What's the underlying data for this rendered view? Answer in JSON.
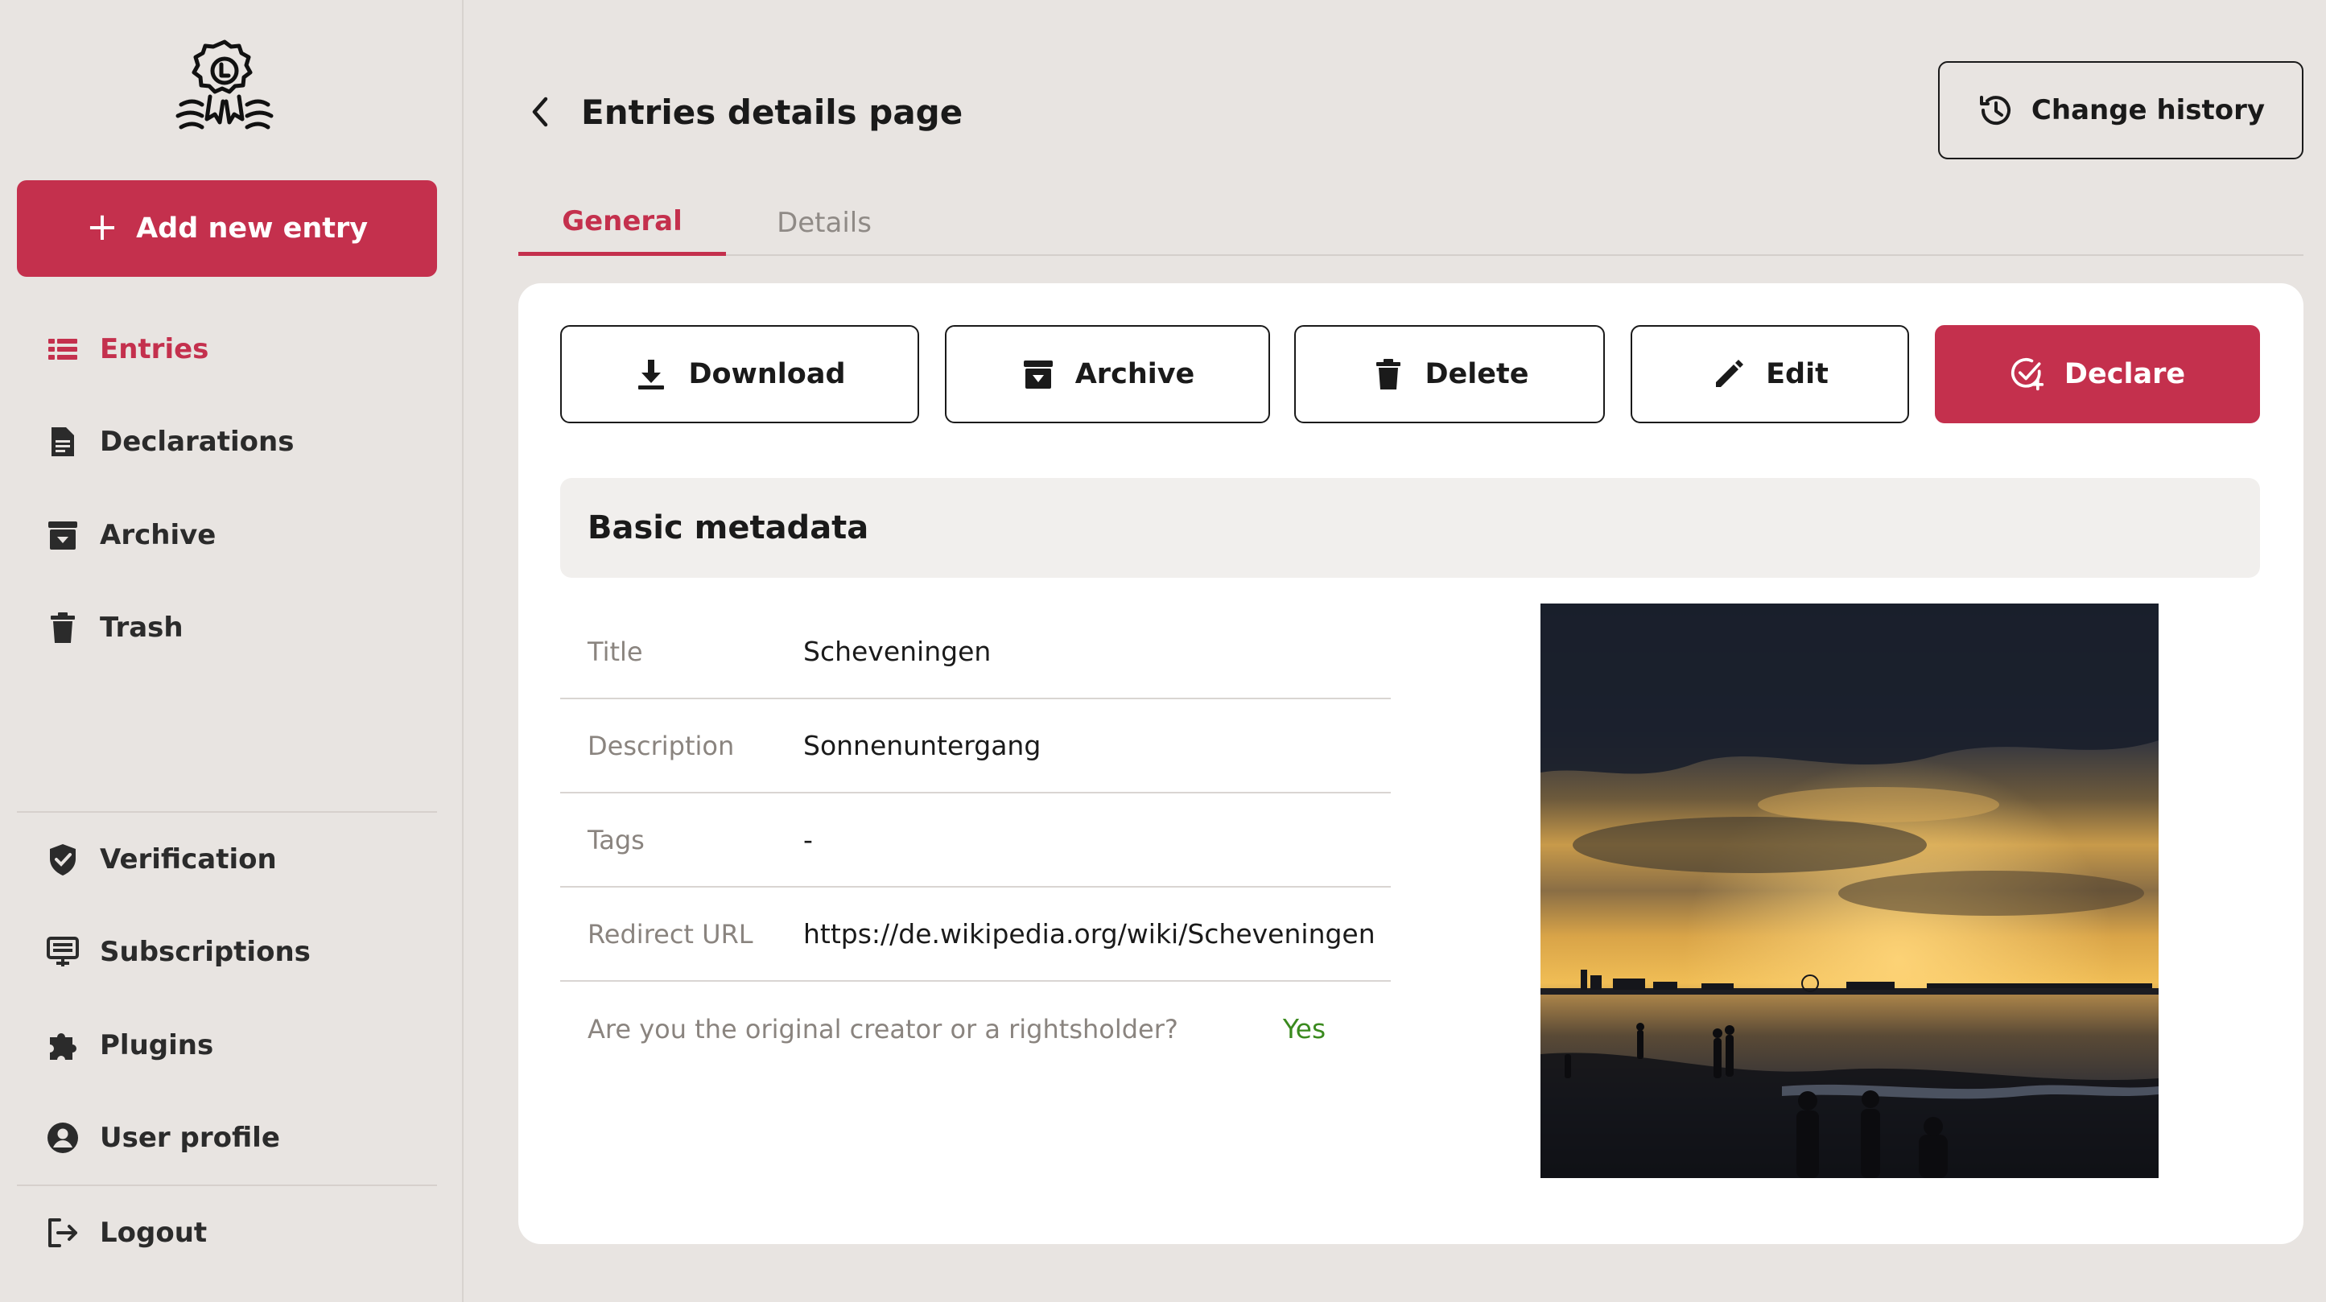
{
  "sidebar": {
    "add_button_label": "Add new entry",
    "items": [
      {
        "label": "Entries",
        "icon": "list-icon",
        "active": true
      },
      {
        "label": "Declarations",
        "icon": "document-icon"
      },
      {
        "label": "Archive",
        "icon": "archive-icon"
      },
      {
        "label": "Trash",
        "icon": "trash-icon"
      }
    ],
    "secondary_items": [
      {
        "label": "Verification",
        "icon": "shield-check-icon"
      },
      {
        "label": "Subscriptions",
        "icon": "subscription-icon"
      },
      {
        "label": "Plugins",
        "icon": "puzzle-icon"
      },
      {
        "label": "User profile",
        "icon": "user-circle-icon"
      }
    ],
    "logout_label": "Logout"
  },
  "header": {
    "title": "Entries details page",
    "change_history_label": "Change history"
  },
  "tabs": [
    {
      "label": "General",
      "active": true
    },
    {
      "label": "Details",
      "active": false
    }
  ],
  "actions": {
    "download": "Download",
    "archive": "Archive",
    "delete": "Delete",
    "edit": "Edit",
    "declare": "Declare"
  },
  "metadata": {
    "section_title": "Basic metadata",
    "rows": [
      {
        "label": "Title",
        "value": "Scheveningen"
      },
      {
        "label": "Description",
        "value": "Sonnenuntergang"
      },
      {
        "label": "Tags",
        "value": "-"
      },
      {
        "label": "Redirect URL",
        "value": "https://de.wikipedia.org/wiki/Scheveningen"
      },
      {
        "label": "Are you the original creator or a rightsholder?",
        "value": "Yes"
      }
    ]
  },
  "colors": {
    "accent": "#c4304d",
    "background": "#e8e4e1",
    "card": "#ffffff",
    "yes": "#3a8a1e"
  }
}
